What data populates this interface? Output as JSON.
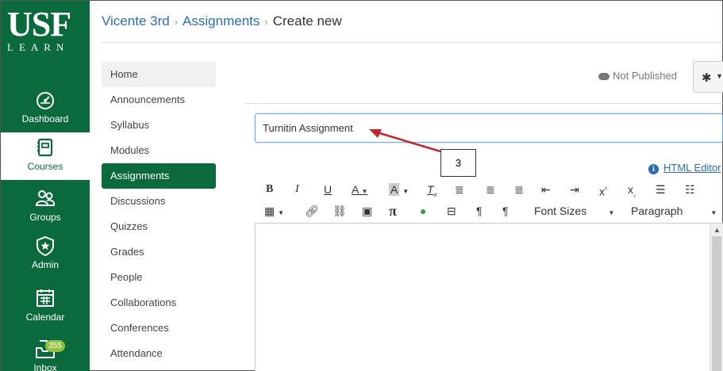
{
  "global_nav": {
    "logo_main": "USF",
    "logo_sub": "LEARN",
    "items": [
      {
        "label": "Dashboard",
        "icon": "dashboard-icon"
      },
      {
        "label": "Courses",
        "icon": "courses-icon"
      },
      {
        "label": "Groups",
        "icon": "groups-icon"
      },
      {
        "label": "Admin",
        "icon": "admin-icon"
      },
      {
        "label": "Calendar",
        "icon": "calendar-icon"
      },
      {
        "label": "Inbox",
        "icon": "inbox-icon",
        "badge": "355"
      }
    ],
    "active": "Courses",
    "color": "#0b6a3c"
  },
  "breadcrumb": {
    "course": "Vicente 3rd",
    "section": "Assignments",
    "current": "Create new",
    "separator": "›"
  },
  "course_nav": {
    "items": [
      "Home",
      "Announcements",
      "Syllabus",
      "Modules",
      "Assignments",
      "Discussions",
      "Quizzes",
      "Grades",
      "People",
      "Collaborations",
      "Conferences",
      "Attendance"
    ],
    "active": "Assignments"
  },
  "status": {
    "publish": "Not Published"
  },
  "form": {
    "title_value": "Turnitin Assignment"
  },
  "annotation": {
    "label": "3",
    "arrow_color": "#c0282d"
  },
  "editor": {
    "html_editor_link": "HTML Editor",
    "font_sizes_label": "Font Sizes",
    "paragraph_label": "Paragraph",
    "toolbar1": [
      "bold-icon",
      "italic-icon",
      "underline-icon",
      "text-color-icon",
      "background-color-icon",
      "clear-formatting-icon",
      "align-left-icon",
      "align-center-icon",
      "align-right-icon",
      "outdent-icon",
      "indent-icon",
      "superscript-icon",
      "subscript-icon",
      "bullet-list-icon",
      "numbered-list-icon"
    ],
    "toolbar2": [
      "table-icon",
      "link-icon",
      "unlink-icon",
      "image-icon",
      "equation-icon",
      "media-icon",
      "embed-icon",
      "ltr-icon",
      "rtl-icon"
    ]
  }
}
